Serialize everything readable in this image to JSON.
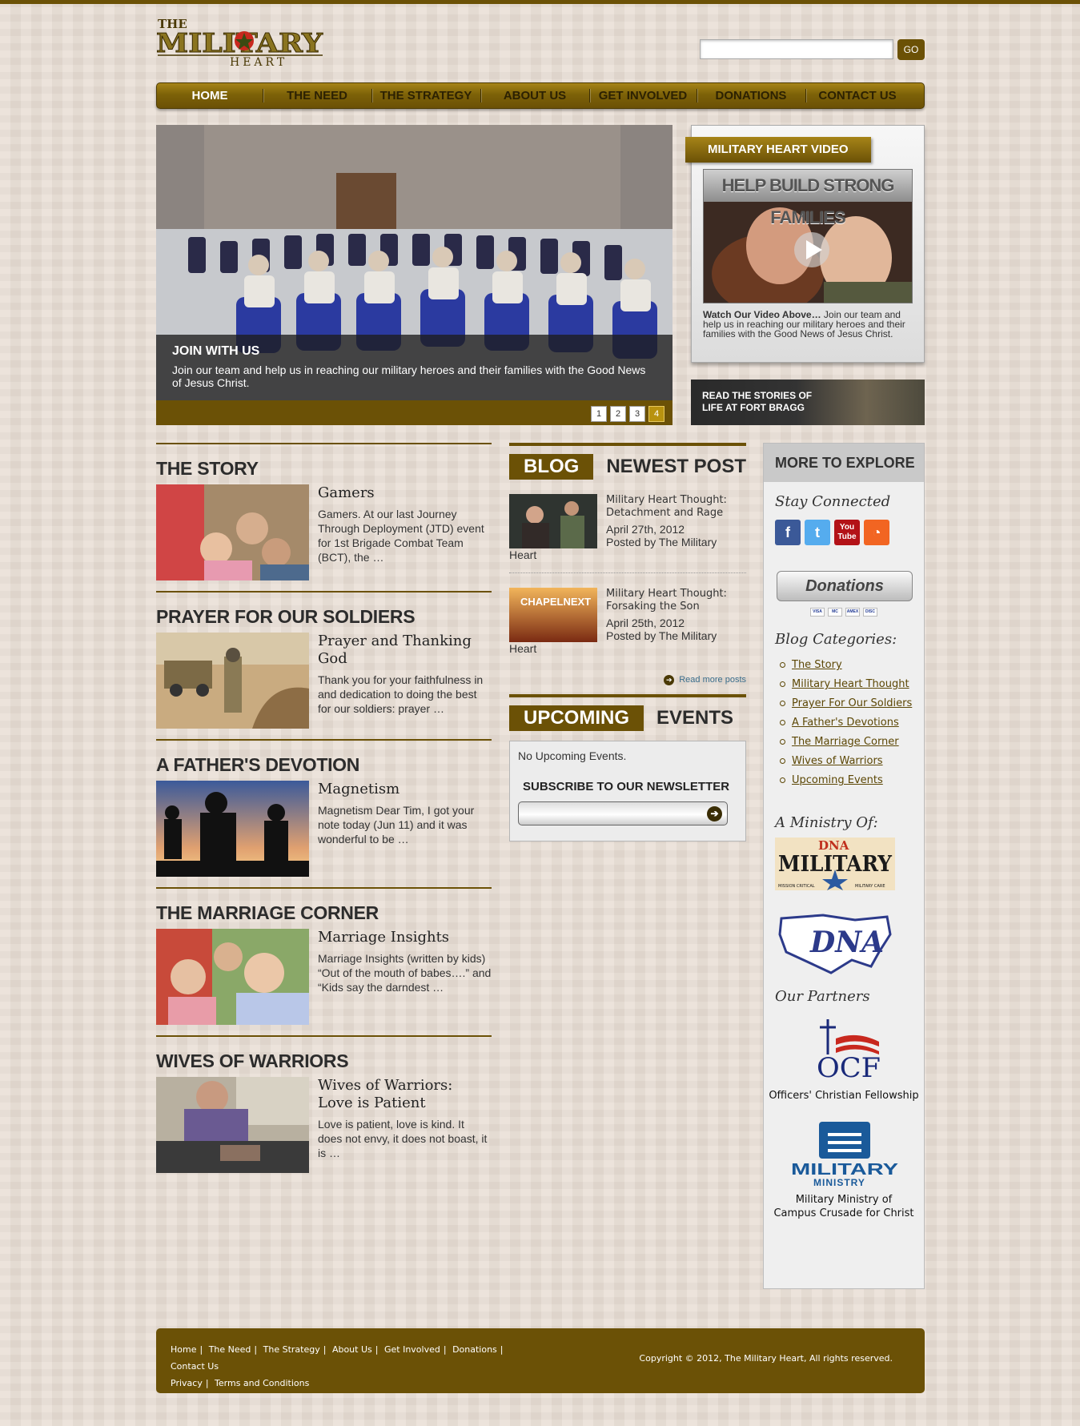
{
  "header": {
    "logo_text_the": "THE",
    "logo_text_military": "MILITARY",
    "logo_text_heart": "HEART",
    "search_value": "",
    "search_button": "GO"
  },
  "nav": [
    "HOME",
    "THE NEED",
    "THE STRATEGY",
    "ABOUT US",
    "GET INVOLVED",
    "DONATIONS",
    "CONTACT US"
  ],
  "slider": {
    "title": "JOIN WITH US",
    "text": "Join our team and help us in reaching our military heroes and their families with the Good News of Jesus Christ.",
    "pages": [
      "1",
      "2",
      "3",
      "4"
    ],
    "active_page": "4"
  },
  "video": {
    "tab": "MILITARY HEART VIDEO",
    "banner": "HELP BUILD STRONG FAMILIES",
    "lead": "Watch Our Video Above…",
    "text": " Join our team and help us in reaching our military heroes and their families with the Good News of Jesus Christ."
  },
  "stories": {
    "line1": "READ THE STORIES OF",
    "line2": "LIFE AT FORT BRAGG"
  },
  "sections": [
    {
      "heading": "THE STORY",
      "title": "Gamers",
      "excerpt": "Gamers.  At our last Journey Through Deployment (JTD) event for 1st Brigade Combat Team (BCT), the …"
    },
    {
      "heading": "PRAYER FOR OUR SOLDIERS",
      "title": "Prayer and Thanking God",
      "excerpt": "Thank you for your faithfulness in and dedication to doing the best for our soldiers: prayer …"
    },
    {
      "heading": "A FATHER'S DEVOTION",
      "title": "Magnetism",
      "excerpt": "Magnetism Dear Tim, I got your note today (Jun 11) and it was wonderful to be …"
    },
    {
      "heading": "THE MARRIAGE CORNER",
      "title": "Marriage Insights",
      "excerpt": "Marriage Insights (written by kids) “Out of the mouth of babes….” and “Kids say the darndest …"
    },
    {
      "heading": "WIVES OF WARRIORS",
      "title": "Wives of Warriors: Love is Patient",
      "excerpt": "Love is patient, love is kind. It does not envy, it does not boast, it is …"
    }
  ],
  "blog": {
    "label_dark": "BLOG",
    "label_light": "NEWEST POST",
    "posts": [
      {
        "title": "Military Heart Thought: Detachment and Rage",
        "date": "April 27th, 2012",
        "by": "Posted by The Military",
        "by2": "Heart",
        "thumb_text": ""
      },
      {
        "title": "Military Heart Thought: Forsaking the Son",
        "date": "April 25th, 2012",
        "by": "Posted by The Military",
        "by2": "Heart",
        "thumb_text": "CHAPELNEXT"
      }
    ],
    "read_more": "Read more posts"
  },
  "events": {
    "label_dark": "UPCOMING",
    "label_light": "EVENTS",
    "none": "No Upcoming Events.",
    "newsletter": "SUBSCRIBE TO OUR NEWSLETTER",
    "newsletter_value": ""
  },
  "explore": {
    "title": "MORE TO EXPLORE",
    "stay_connected": "Stay Connected",
    "social": [
      {
        "name": "facebook-icon",
        "glyph": "f",
        "color": "#3b5998"
      },
      {
        "name": "twitter-icon",
        "glyph": "t",
        "color": "#55acee"
      },
      {
        "name": "youtube-icon",
        "glyph": "You Tube",
        "color": "#b31217"
      },
      {
        "name": "rss-icon",
        "glyph": "◔",
        "color": "#f26522"
      }
    ],
    "donations": "Donations",
    "cards": [
      "VISA",
      "MC",
      "AMEX",
      "DISC"
    ],
    "categories_title": "Blog Categories:",
    "categories": [
      "The Story",
      "Military Heart Thought",
      "Prayer For Our Soldiers",
      "A Father's Devotions",
      "The Marriage Corner",
      "Wives of Warriors",
      "Upcoming Events"
    ],
    "ministry_title": "A Ministry Of:",
    "dna_military_top": "DNA",
    "dna_military_main": "MILITARY",
    "dna_military_left": "MISSION CRITICAL",
    "dna_military_right": "MILITARY CARE",
    "dna_logo": "DNA",
    "partners_title": "Our Partners",
    "ocf_logo": "OCF",
    "ocf_name": "Officers' Christian Fellowship",
    "mm_logo_top": "MILITARY",
    "mm_logo_bottom": "MINISTRY",
    "mm_name": "Military Ministry of Campus Crusade for Christ"
  },
  "footer": {
    "links_row1": [
      "Home",
      "The Need",
      "The Strategy",
      "About Us",
      "Get Involved",
      "Donations",
      "Contact Us"
    ],
    "links_row2": [
      "Privacy",
      "Terms and Conditions"
    ],
    "copyright": "Copyright © 2012, The Military Heart, All rights reserved."
  },
  "colors": {
    "brand": "#6b5106",
    "background": "#e8ddd4",
    "link": "#5c4705"
  }
}
